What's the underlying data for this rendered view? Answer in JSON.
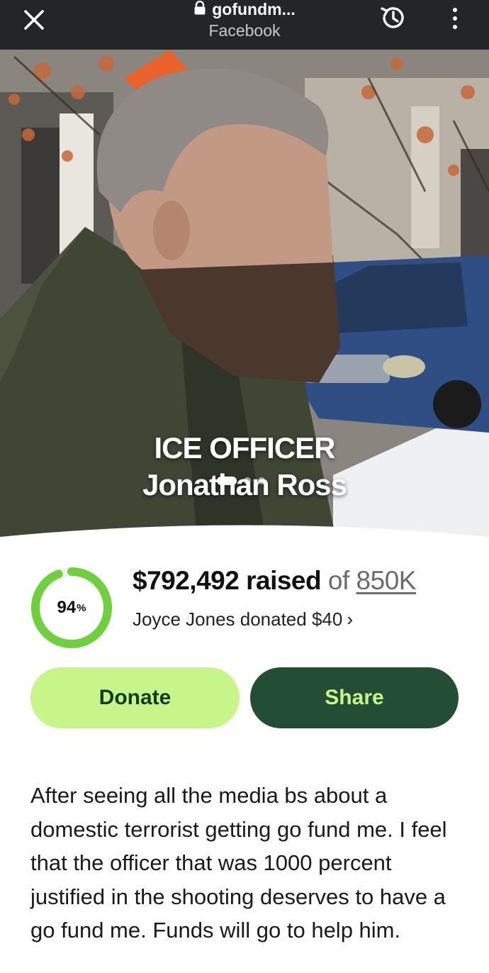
{
  "topbar": {
    "url": "gofundm...",
    "source": "Facebook"
  },
  "hero": {
    "title_line1": "ICE OFFICER",
    "title_line2": "Jonathan Ross",
    "slides_total": 3,
    "slide_active": 1
  },
  "fundraiser": {
    "progress_percent": 94,
    "percent_value": "94",
    "percent_sign": "%",
    "raised_amount": "$792,492 raised",
    "of_text": "of",
    "goal": "850K",
    "recent_donation": "Joyce Jones donated $40",
    "recent_chevron": "›"
  },
  "actions": {
    "donate_label": "Donate",
    "share_label": "Share"
  },
  "story": {
    "text": "After seeing all the media bs about a domestic terrorist getting go fund me. I feel that the officer that was 1000 percent justified in the shooting deserves to have a go fund me. Funds will go to help him."
  },
  "colors": {
    "accent_light": "#c8f58a",
    "accent_dark": "#234d35",
    "progress": "#6fcf3d",
    "topbar_bg": "#242526"
  },
  "icons": [
    "close-icon",
    "lock-icon",
    "history-icon",
    "more-vertical-icon"
  ]
}
